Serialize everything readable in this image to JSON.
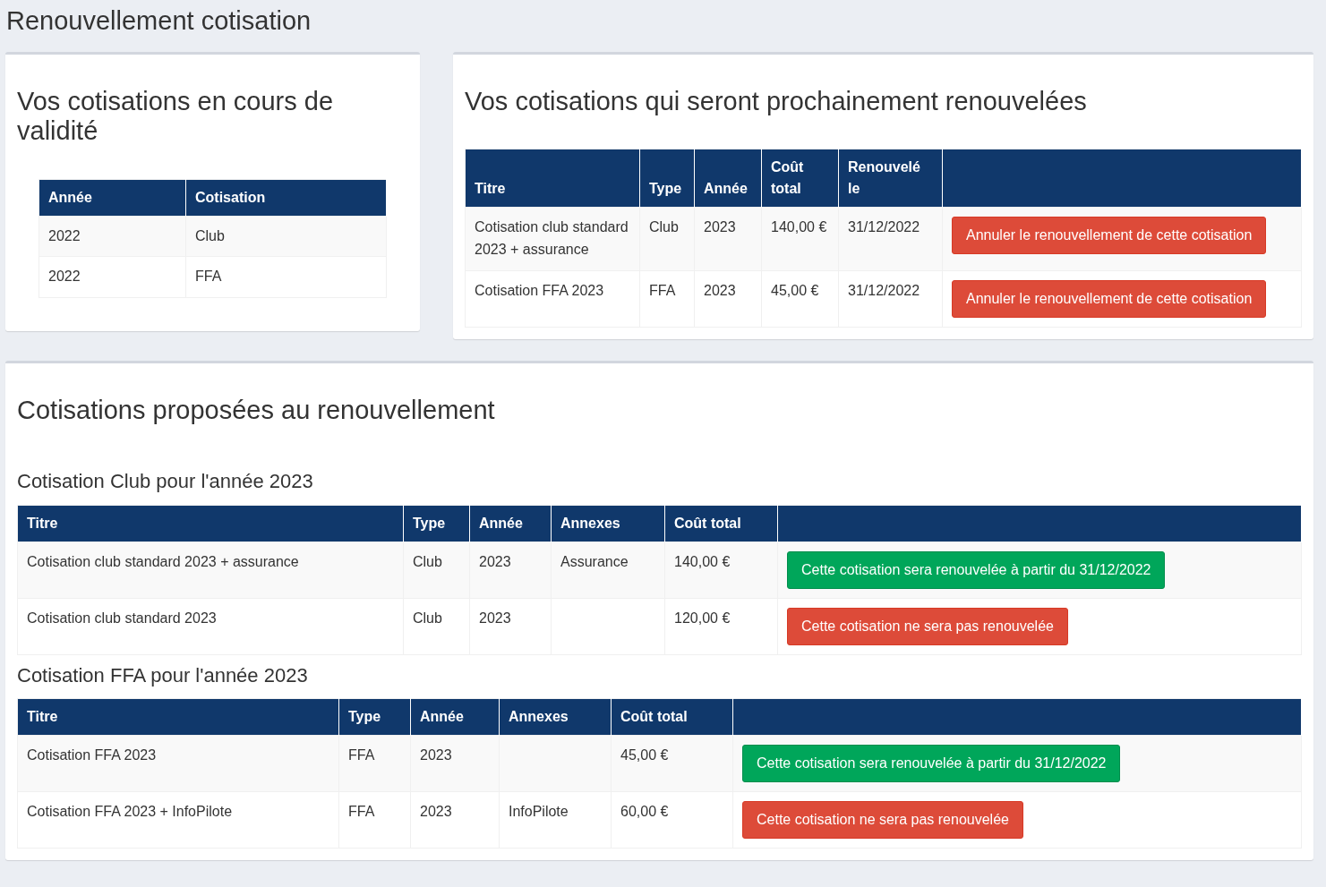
{
  "page_title": "Renouvellement cotisation",
  "current": {
    "title": "Vos cotisations en cours de validité",
    "columns": [
      "Année",
      "Cotisation"
    ],
    "rows": [
      {
        "year": "2022",
        "name": "Club"
      },
      {
        "year": "2022",
        "name": "FFA"
      }
    ]
  },
  "upcoming": {
    "title": "Vos cotisations qui seront prochainement renouvelées",
    "columns": [
      "Titre",
      "Type",
      "Année",
      "Coût total",
      "Renouvelé le"
    ],
    "rows": [
      {
        "title": "Cotisation club standard 2023 + assurance",
        "type": "Club",
        "year": "2023",
        "cost": "140,00 €",
        "renewed": "31/12/2022",
        "button": {
          "label": "Annuler le renouvellement de cette cotisation",
          "kind": "cancel"
        }
      },
      {
        "title": "Cotisation FFA 2023",
        "type": "FFA",
        "year": "2023",
        "cost": "45,00 €",
        "renewed": "31/12/2022",
        "button": {
          "label": "Annuler le renouvellement de cette cotisation",
          "kind": "cancel"
        }
      }
    ]
  },
  "proposed": {
    "title": "Cotisations proposées au renouvellement",
    "groups": [
      {
        "title": "Cotisation Club pour l'année 2023",
        "columns": [
          "Titre",
          "Type",
          "Année",
          "Annexes",
          "Coût total"
        ],
        "rows": [
          {
            "title": "Cotisation club standard 2023 + assurance",
            "type": "Club",
            "year": "2023",
            "annexes": "Assurance",
            "cost": "140,00 €",
            "button": {
              "label": "Cette cotisation sera renouvelée à partir du 31/12/2022",
              "kind": "renew"
            }
          },
          {
            "title": "Cotisation club standard 2023",
            "type": "Club",
            "year": "2023",
            "cost": "120,00 €",
            "button": {
              "label": "Cette cotisation ne sera pas renouvelée",
              "kind": "decline"
            }
          }
        ]
      },
      {
        "title": "Cotisation FFA pour l'année 2023",
        "columns": [
          "Titre",
          "Type",
          "Année",
          "Annexes",
          "Coût total"
        ],
        "rows": [
          {
            "title": "Cotisation FFA 2023",
            "type": "FFA",
            "year": "2023",
            "cost": "45,00 €",
            "button": {
              "label": "Cette cotisation sera renouvelée à partir du 31/12/2022",
              "kind": "renew"
            }
          },
          {
            "title": "Cotisation FFA 2023 + InfoPilote",
            "type": "FFA",
            "year": "2023",
            "annexes": "InfoPilote",
            "cost": "60,00 €",
            "button": {
              "label": "Cette cotisation ne sera pas renouvelée",
              "kind": "decline"
            }
          }
        ]
      }
    ]
  }
}
